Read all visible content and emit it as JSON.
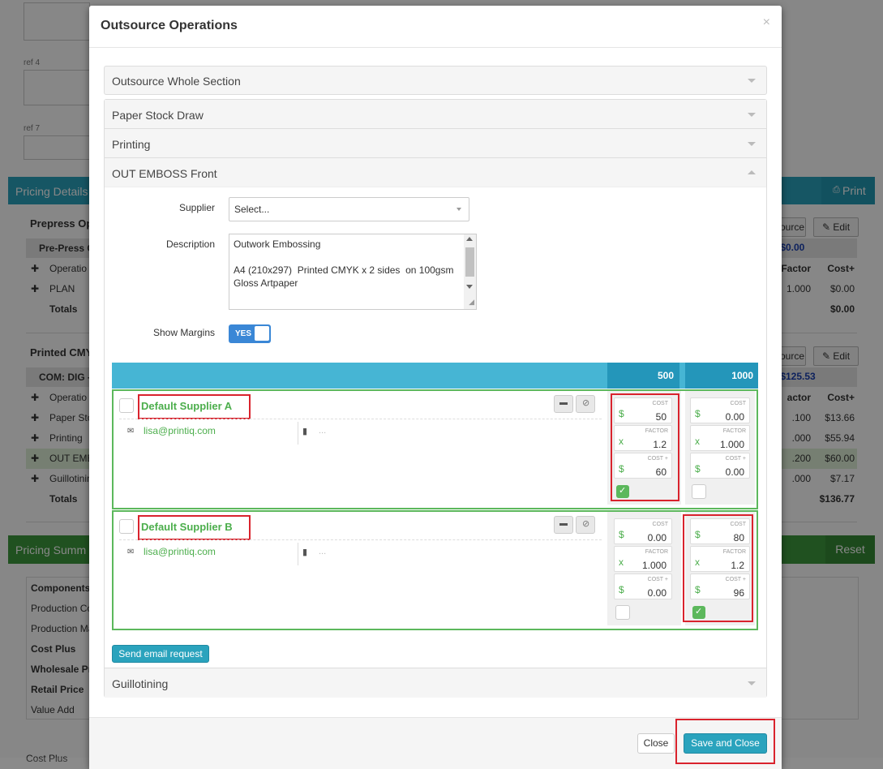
{
  "background": {
    "labels": {
      "ref4": "ref 4",
      "ref7": "ref 7"
    },
    "pricing_details": {
      "title": "Pricing Details",
      "print_label": "Print"
    },
    "prepress": {
      "title": "Prepress Op",
      "subheader": "Pre-Press C",
      "col_operation": "Operatio",
      "row1": "PLAN",
      "totals": "Totals",
      "source_btn": "ource",
      "edit_btn": "Edit",
      "amount": ": $0.00",
      "factor_hdr": "Factor",
      "cost_hdr": "Cost+",
      "plan_factor": "1.000",
      "plan_cost": "$0.00",
      "totals_cost": "$0.00"
    },
    "printed": {
      "title": "Printed CMY",
      "subheader": "COM: DIG -",
      "col_operation": "Operatio",
      "rows": [
        "Paper Sto",
        "Printing",
        "OUT EMB",
        "Guillotinin"
      ],
      "totals": "Totals",
      "source_btn": "ource",
      "edit_btn": "Edit",
      "amount": ": $125.53",
      "factor_hdr": "actor",
      "cost_hdr": "Cost+",
      "factors": [
        ".100",
        ".000",
        ".200",
        ".000"
      ],
      "costs": [
        "$13.66",
        "$55.94",
        "$60.00",
        "$7.17"
      ],
      "totals_cost": "$136.77"
    },
    "pricing_summary": {
      "title": "Pricing Summ",
      "reset_label": "Reset",
      "rows": [
        "Components",
        "Production Co",
        "Production Ma",
        "Cost Plus",
        "Wholesale Pr",
        "Retail Price",
        "Value Add"
      ]
    },
    "bottom_cut": "Cost Plus"
  },
  "modal": {
    "title": "Outsource Operations",
    "close_x": "×",
    "sections": {
      "whole": "Outsource Whole Section",
      "paper": "Paper Stock Draw",
      "printing": "Printing",
      "emboss": "OUT EMBOSS Front",
      "guillotining": "Guillotining"
    },
    "form": {
      "supplier_label": "Supplier",
      "supplier_value": "Select...",
      "description_label": "Description",
      "description_value": "Outwork Embossing\n\nA4 (210x297)  Printed CMYK x 2 sides  on 100gsm\nGloss Artpaper",
      "show_margins_label": "Show Margins",
      "show_margins_value": "YES"
    },
    "quantities": [
      "500",
      "1000"
    ],
    "suppliers": [
      {
        "name": "Default Supplier A",
        "email": "lisa@printiq.com",
        "note": "...",
        "columns": [
          {
            "cost": "50",
            "factor": "1.2",
            "cost_plus": "60",
            "selected": true
          },
          {
            "cost": "0.00",
            "factor": "1.000",
            "cost_plus": "0.00",
            "selected": false
          }
        ]
      },
      {
        "name": "Default Supplier B",
        "email": "lisa@printiq.com",
        "note": "...",
        "columns": [
          {
            "cost": "0.00",
            "factor": "1.000",
            "cost_plus": "0.00",
            "selected": false
          },
          {
            "cost": "80",
            "factor": "1.2",
            "cost_plus": "96",
            "selected": true
          }
        ]
      }
    ],
    "field_labels": {
      "cost": "COST",
      "factor": "FACTOR",
      "cost_plus": "COST +",
      "dollar": "$",
      "times": "x"
    },
    "send_email_label": "Send email request",
    "footer": {
      "close_label": "Close",
      "save_label": "Save and Close"
    }
  },
  "colors": {
    "accent": "#2aa3bd",
    "success": "#5cb85c",
    "highlight": "#d9232d",
    "toggle": "#3a87d6"
  }
}
